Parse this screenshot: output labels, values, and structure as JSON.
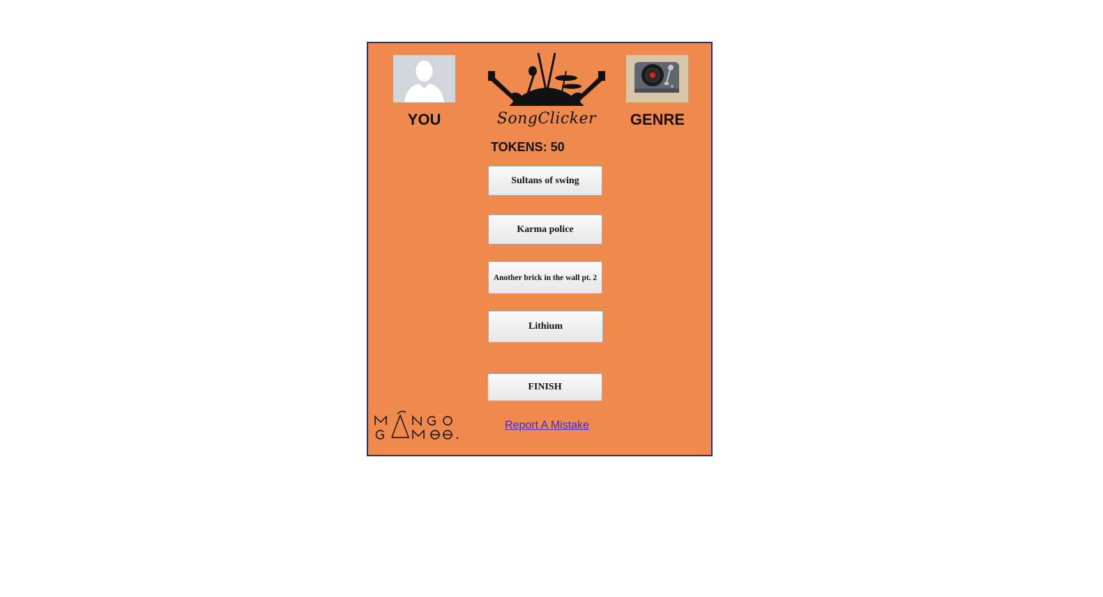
{
  "player": {
    "label": "YOU",
    "avatar_icon": "user-silhouette-icon"
  },
  "genre": {
    "label": "GENRE",
    "avatar_icon": "turntable-icon"
  },
  "logo": {
    "text": "SongClicker"
  },
  "tokens": {
    "text": "TOKENS: 50"
  },
  "songs": [
    {
      "label": "Sultans of swing"
    },
    {
      "label": "Karma police"
    },
    {
      "label": "Another brick in the wall pt. 2"
    },
    {
      "label": "Lithium"
    }
  ],
  "finish": {
    "label": "FINISH"
  },
  "footer": {
    "brand_logo": "mango-games-logo",
    "report_link": "Report A Mistake"
  },
  "colors": {
    "panel_bg": "#f0894c",
    "panel_border": "#22327a",
    "link": "#3b2bd6"
  }
}
